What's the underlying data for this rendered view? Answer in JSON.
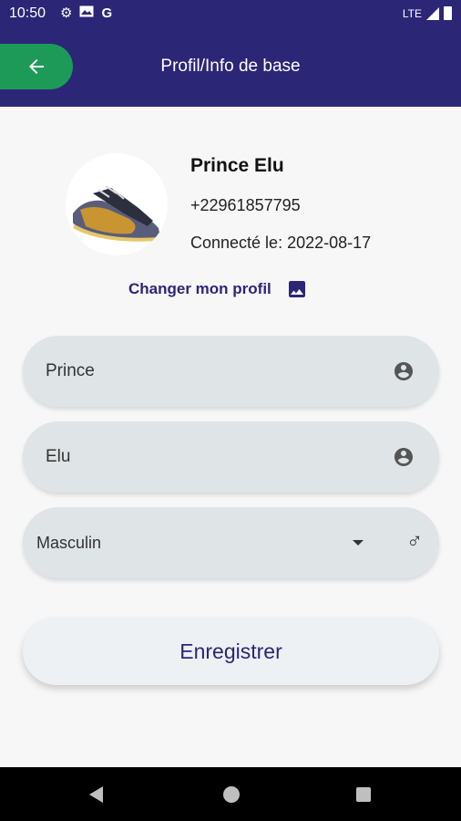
{
  "status_bar": {
    "time": "10:50",
    "network": "LTE",
    "icons": [
      "gear-icon",
      "mail-icon",
      "google-icon",
      "signal-icon",
      "battery-icon"
    ]
  },
  "app_bar": {
    "title": "Profil/Info de base",
    "back_icon": "arrow-left-icon",
    "colors": {
      "background": "#2c2677",
      "back_button": "#1e9a58"
    }
  },
  "profile": {
    "name": "Prince Elu",
    "phone": "+22961857795",
    "connected": "Connecté le: 2022-08-17",
    "change_label": "Changer mon profil",
    "change_icon": "image-icon"
  },
  "form": {
    "first_name": {
      "value": "Prince",
      "icon": "person-icon"
    },
    "last_name": {
      "value": "Elu",
      "icon": "person-icon"
    },
    "gender": {
      "value": "Masculin",
      "icon": "male-icon"
    },
    "save_label": "Enregistrer"
  },
  "nav_bar": {
    "icons": [
      "back-icon",
      "home-icon",
      "recents-icon"
    ]
  }
}
